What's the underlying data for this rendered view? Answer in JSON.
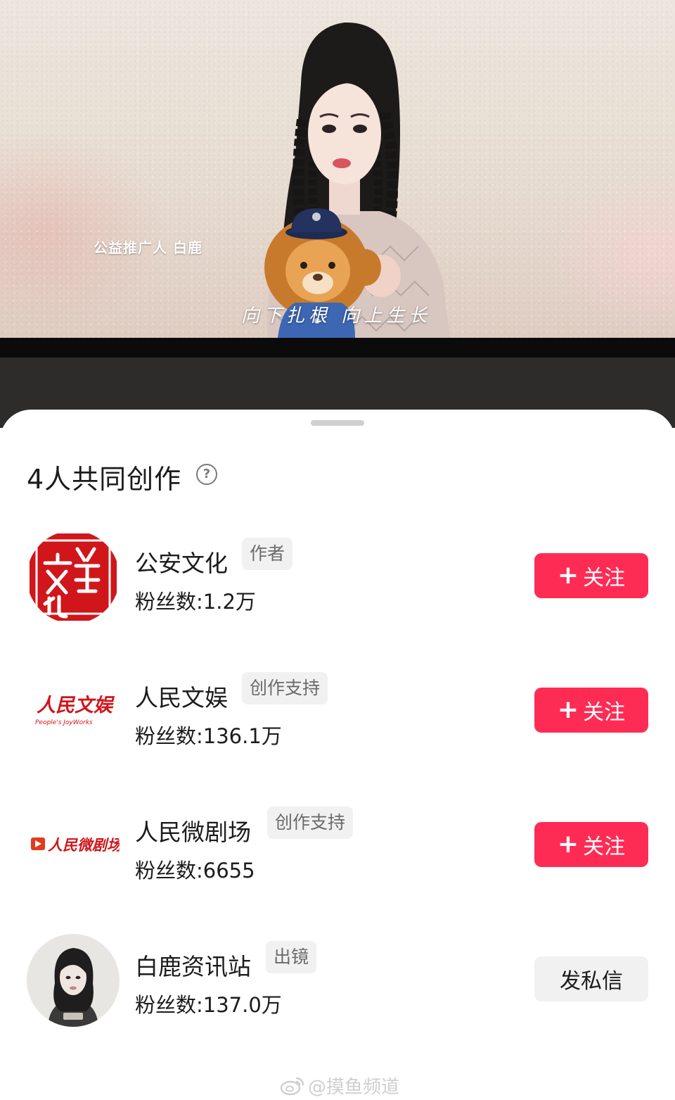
{
  "video": {
    "caption": "公益推广人  白鹿",
    "subtitle": "向下扎根 向上生长"
  },
  "sheet": {
    "title": "4人共同创作",
    "help_icon": "question-circle-icon"
  },
  "creators": [
    {
      "name": "公安文化",
      "role": "作者",
      "fans": "粉丝数:1.2万",
      "action": "关注",
      "action_type": "follow",
      "logo_text": "公安文化"
    },
    {
      "name": "人民文娱",
      "role": "创作支持",
      "fans": "粉丝数:136.1万",
      "action": "关注",
      "action_type": "follow",
      "logo_text": "人民文娱",
      "logo_subtext": "People's JoyWorks"
    },
    {
      "name": "人民微剧场",
      "role": "创作支持",
      "fans": "粉丝数:6655",
      "action": "关注",
      "action_type": "follow",
      "logo_text": "人民微剧场"
    },
    {
      "name": "白鹿资讯站",
      "role": "出镜",
      "fans": "粉丝数:137.0万",
      "action": "发私信",
      "action_type": "message"
    }
  ],
  "watermark": "@摸鱼频道",
  "colors": {
    "follow_button": "#fe2c55",
    "message_button": "#f1f1f1",
    "tag_background": "#f1f1f1"
  }
}
